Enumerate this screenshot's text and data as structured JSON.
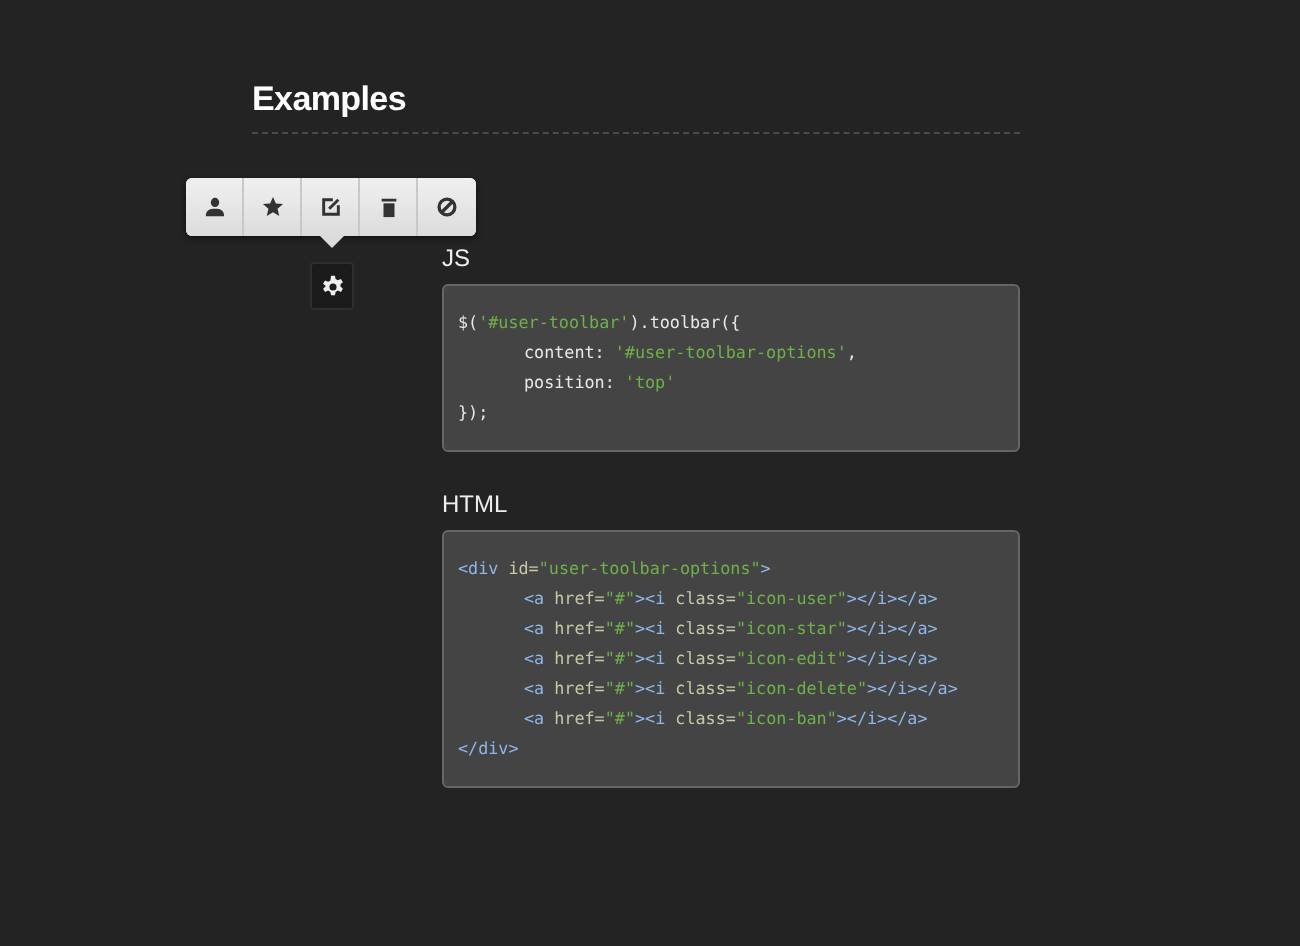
{
  "heading": "Examples",
  "toolbar": {
    "buttons": [
      {
        "kind": "user"
      },
      {
        "kind": "star"
      },
      {
        "kind": "edit"
      },
      {
        "kind": "trash"
      },
      {
        "kind": "ban"
      }
    ]
  },
  "sections": [
    {
      "label": "JS",
      "lines": [
        {
          "indented": false,
          "tokens": [
            {
              "kind": "plain",
              "text": "$("
            },
            {
              "kind": "string",
              "text": "'#user-toolbar'"
            },
            {
              "kind": "plain",
              "text": ").toolbar({"
            }
          ]
        },
        {
          "indented": true,
          "tokens": [
            {
              "kind": "plain",
              "text": "content: "
            },
            {
              "kind": "string",
              "text": "'#user-toolbar-options'"
            },
            {
              "kind": "plain",
              "text": ","
            }
          ]
        },
        {
          "indented": true,
          "tokens": [
            {
              "kind": "plain",
              "text": "position: "
            },
            {
              "kind": "string",
              "text": "'top'"
            }
          ]
        },
        {
          "indented": false,
          "tokens": [
            {
              "kind": "plain",
              "text": "});"
            }
          ]
        }
      ]
    },
    {
      "label": "HTML",
      "lines": [
        {
          "indented": false,
          "tokens": [
            {
              "kind": "tag",
              "text": "<div "
            },
            {
              "kind": "attr",
              "text": "id="
            },
            {
              "kind": "string",
              "text": "\"user-toolbar-options\""
            },
            {
              "kind": "tag",
              "text": ">"
            }
          ]
        },
        {
          "indented": true,
          "tokens": [
            {
              "kind": "tag",
              "text": "<a "
            },
            {
              "kind": "attr",
              "text": "href="
            },
            {
              "kind": "string",
              "text": "\"#\""
            },
            {
              "kind": "tag",
              "text": "><i "
            },
            {
              "kind": "attr",
              "text": "class="
            },
            {
              "kind": "string",
              "text": "\"icon-user\""
            },
            {
              "kind": "tag",
              "text": "></i></a>"
            }
          ]
        },
        {
          "indented": true,
          "tokens": [
            {
              "kind": "tag",
              "text": "<a "
            },
            {
              "kind": "attr",
              "text": "href="
            },
            {
              "kind": "string",
              "text": "\"#\""
            },
            {
              "kind": "tag",
              "text": "><i "
            },
            {
              "kind": "attr",
              "text": "class="
            },
            {
              "kind": "string",
              "text": "\"icon-star\""
            },
            {
              "kind": "tag",
              "text": "></i></a>"
            }
          ]
        },
        {
          "indented": true,
          "tokens": [
            {
              "kind": "tag",
              "text": "<a "
            },
            {
              "kind": "attr",
              "text": "href="
            },
            {
              "kind": "string",
              "text": "\"#\""
            },
            {
              "kind": "tag",
              "text": "><i "
            },
            {
              "kind": "attr",
              "text": "class="
            },
            {
              "kind": "string",
              "text": "\"icon-edit\""
            },
            {
              "kind": "tag",
              "text": "></i></a>"
            }
          ]
        },
        {
          "indented": true,
          "tokens": [
            {
              "kind": "tag",
              "text": "<a "
            },
            {
              "kind": "attr",
              "text": "href="
            },
            {
              "kind": "string",
              "text": "\"#\""
            },
            {
              "kind": "tag",
              "text": "><i "
            },
            {
              "kind": "attr",
              "text": "class="
            },
            {
              "kind": "string",
              "text": "\"icon-delete\""
            },
            {
              "kind": "tag",
              "text": "></i></a>"
            }
          ]
        },
        {
          "indented": true,
          "tokens": [
            {
              "kind": "tag",
              "text": "<a "
            },
            {
              "kind": "attr",
              "text": "href="
            },
            {
              "kind": "string",
              "text": "\"#\""
            },
            {
              "kind": "tag",
              "text": "><i "
            },
            {
              "kind": "attr",
              "text": "class="
            },
            {
              "kind": "string",
              "text": "\"icon-ban\""
            },
            {
              "kind": "tag",
              "text": "></i></a>"
            }
          ]
        },
        {
          "indented": false,
          "tokens": [
            {
              "kind": "tag",
              "text": "</div>"
            }
          ]
        }
      ]
    }
  ]
}
